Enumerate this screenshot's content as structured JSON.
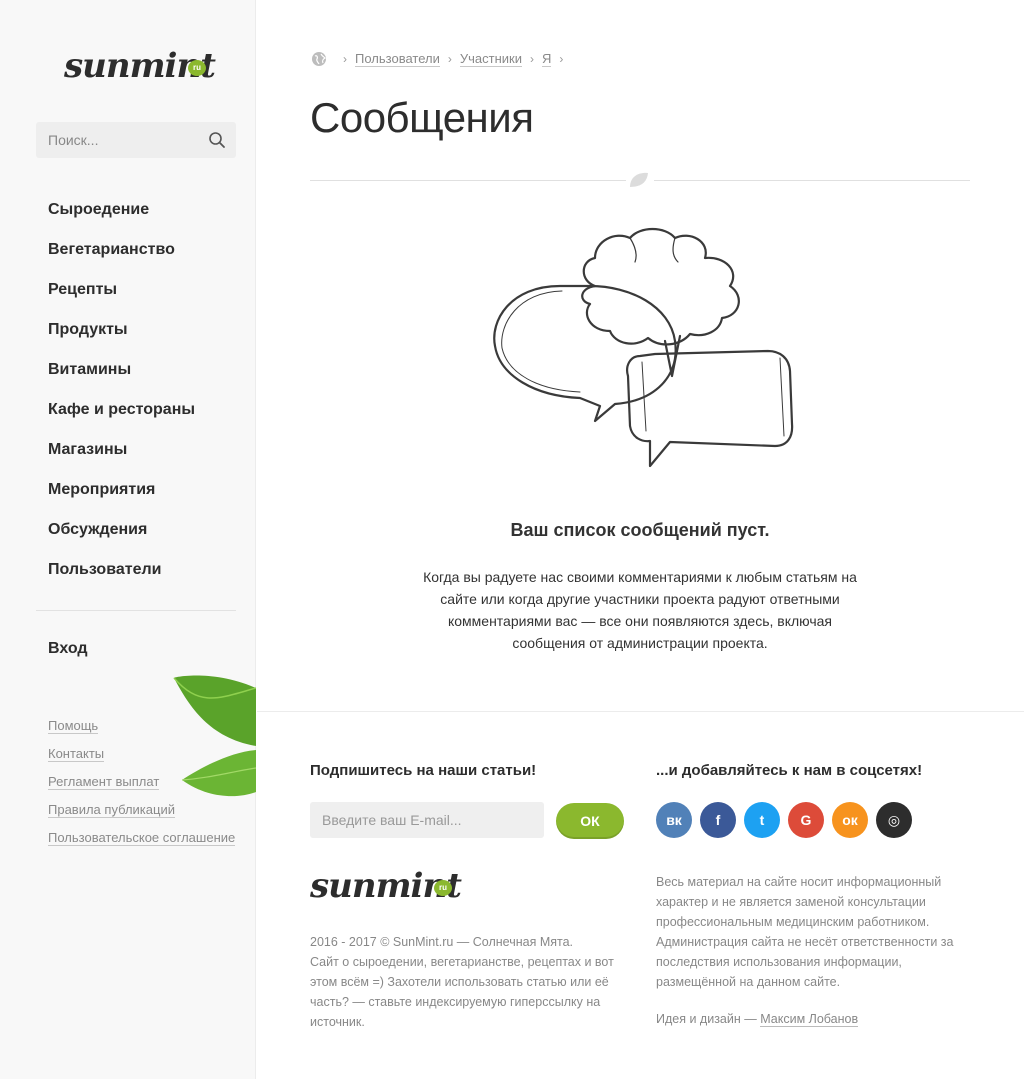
{
  "brand": {
    "logo_text": "sunmint",
    "logo_badge": "ru"
  },
  "search": {
    "placeholder": "Поиск..."
  },
  "nav": [
    "Сыроедение",
    "Вегетарианство",
    "Рецепты",
    "Продукты",
    "Витамины",
    "Кафе и рестораны",
    "Магазины",
    "Мероприятия",
    "Обсуждения",
    "Пользователи"
  ],
  "login_label": "Вход",
  "footer_links": [
    "Помощь",
    "Контакты",
    "Регламент выплат",
    "Правила публикаций",
    "Пользовательское соглашение"
  ],
  "breadcrumb": [
    "Пользователи",
    "Участники",
    "Я"
  ],
  "page_title": "Сообщения",
  "empty": {
    "title": "Ваш список сообщений пуст.",
    "text": "Когда вы радуете нас своими комментариями к любым статьям на сайте или когда другие участники проекта радуют ответными комментариями вас — все они появляются здесь, включая сообщения от администрации проекта."
  },
  "subscribe": {
    "title": "Подпишитесь на наши статьи!",
    "placeholder": "Введите ваш E-mail...",
    "button": "ОК"
  },
  "copyright": {
    "line1": "2016 - 2017 © SunMint.ru — Солнечная Мята.",
    "line2": "Сайт о сыроедении, вегетарианстве, рецептах и вот этом всём =) Захотели использовать статью или её часть? — ставьте индексируемую гиперссылку на источник."
  },
  "social": {
    "title": "...и добавляйтесь к нам в соцсетях!",
    "items": [
      {
        "name": "vk-icon",
        "glyph": "вк",
        "color": "#5181b8"
      },
      {
        "name": "facebook-icon",
        "glyph": "f",
        "color": "#3b5998"
      },
      {
        "name": "twitter-icon",
        "glyph": "t",
        "color": "#1da1f2"
      },
      {
        "name": "google-icon",
        "glyph": "G",
        "color": "#dd4b39"
      },
      {
        "name": "odnoklassniki-icon",
        "glyph": "ок",
        "color": "#f7931e"
      },
      {
        "name": "instagram-icon",
        "glyph": "◎",
        "color": "#2d2d2d"
      }
    ]
  },
  "disclaimer": "Весь материал на сайте носит информационный характер и не является заменой консультации профессиональным медицинским работником. Администрация сайта не несёт ответственности за последствия использования информации, размещённой на данном сайте.",
  "credits": {
    "prefix": "Идея и дизайн — ",
    "author": "Максим Лобанов"
  },
  "colors": {
    "accent": "#8bb82e",
    "text": "#2d2d2d",
    "muted": "#888888"
  }
}
